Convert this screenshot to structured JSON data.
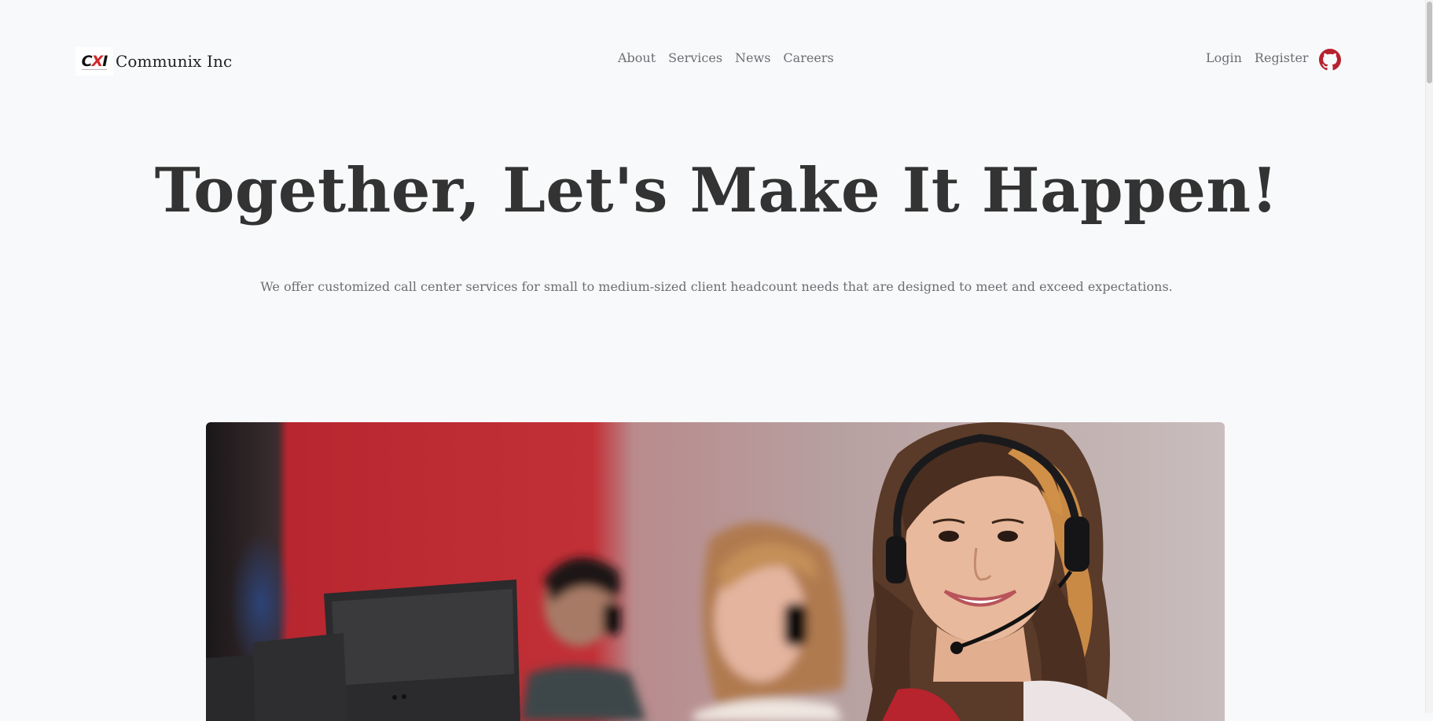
{
  "brand": {
    "logo_text_left": "C",
    "logo_text_x": "X",
    "logo_text_right": "I",
    "name": "Communix Inc"
  },
  "nav": {
    "center": [
      {
        "label": "About"
      },
      {
        "label": "Services"
      },
      {
        "label": "News"
      },
      {
        "label": "Careers"
      }
    ],
    "right": [
      {
        "label": "Login"
      },
      {
        "label": "Register"
      }
    ],
    "github_icon": "github-icon"
  },
  "hero": {
    "title": "Together, Let's Make It Happen!",
    "subtitle": "We offer customized call center services for small to medium-sized client headcount needs that are designed to meet and exceed expectations."
  },
  "colors": {
    "background": "#f8f9fa",
    "text_dark": "#333333",
    "text_muted": "#6b6f73",
    "accent_red": "#b8212f"
  }
}
